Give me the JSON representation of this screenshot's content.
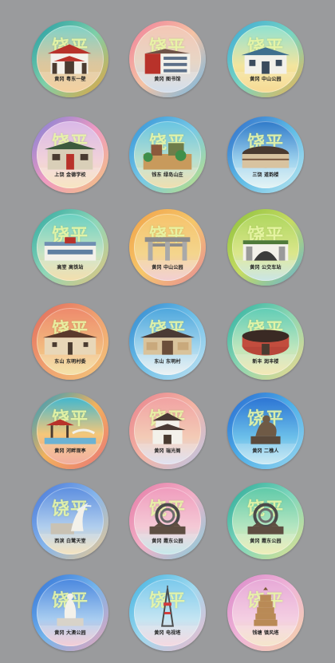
{
  "watermark": "饶平",
  "badges": [
    {
      "label": "黄冈 粤东一壁",
      "ring": "linear-gradient(135deg,#1f9aa6,#7fd0a8,#e9a23a)",
      "bg": "linear-gradient(180deg,#7fd2c8,#d9c7a0 55%,#f2c68a)",
      "icon": "gate-arch-icon"
    },
    {
      "label": "黄冈 图书馆",
      "ring": "linear-gradient(135deg,#f07c9a,#f5c3a4,#6fb8e6)",
      "bg": "linear-gradient(180deg,#f4c7b5,#e7d6c6 55%,#c9d7e8)",
      "icon": "library-building-icon"
    },
    {
      "label": "黄冈 中山公园",
      "ring": "linear-gradient(135deg,#3aa6d8,#78d6c2,#f2b24c)",
      "bg": "linear-gradient(180deg,#8fe1d2,#f3e59e 60%,#f6d27c)",
      "icon": "park-pavilion-icon"
    },
    {
      "label": "上饶 金德学校",
      "ring": "linear-gradient(135deg,#7a7fd8,#ef9ac2,#f2c57c)",
      "bg": "linear-gradient(180deg,#d9b8e8,#f2d3d9 60%,#f6e0b4)",
      "icon": "school-building-icon"
    },
    {
      "label": "钱东 绿岛山庄",
      "ring": "linear-gradient(135deg,#2f8fd8,#77c9e6,#c3e27a)",
      "bg": "linear-gradient(180deg,#67c4e2,#b9e0cf 60%,#ecd79d)",
      "icon": "resort-building-icon"
    },
    {
      "label": "三饶 道韵楼",
      "ring": "linear-gradient(135deg,#2e68c8,#5dbbe6,#bfe8f0)",
      "bg": "linear-gradient(180deg,#2f7ac9,#9fd3ee 60%,#dff2f3)",
      "icon": "tulou-icon"
    },
    {
      "label": "高堂 高铁站",
      "ring": "linear-gradient(135deg,#2aa6a0,#8fd7b8,#e4c37a)",
      "bg": "linear-gradient(180deg,#6ad0c1,#c6e3c3 60%,#f1d79b)",
      "icon": "station-icon"
    },
    {
      "label": "黄冈 中山公园",
      "ring": "linear-gradient(135deg,#f0a048,#f6c76a,#e68a9a)",
      "bg": "linear-gradient(180deg,#f6c36b,#f4d58d 60%,#eec4c9)",
      "icon": "memorial-arch-icon"
    },
    {
      "label": "黄冈 公交车站",
      "ring": "linear-gradient(135deg,#8cbf3c,#c6dc63,#5fb1d8)",
      "bg": "linear-gradient(180deg,#aed65e,#dbe78c 60%,#bfe0e1)",
      "icon": "bus-station-icon"
    },
    {
      "label": "东山 东明村委",
      "ring": "linear-gradient(135deg,#e06a5c,#f0a070,#f3c77a)",
      "bg": "linear-gradient(180deg,#ee8a6c,#f2ba7f 60%,#f2dc98)",
      "icon": "village-hall-icon"
    },
    {
      "label": "东山 东明村",
      "ring": "linear-gradient(135deg,#2f86cf,#6ec0e8,#c4e3f2)",
      "bg": "linear-gradient(180deg,#4ea7dd,#a4d6ee 60%,#e8eff1)",
      "icon": "ancestral-hall-icon"
    },
    {
      "label": "新丰 润丰楼",
      "ring": "linear-gradient(135deg,#2bb0a2,#8ed7b2,#f3d98a)",
      "bg": "linear-gradient(180deg,#61cdb6,#bde6bd 60%,#f2e3a6)",
      "icon": "round-tulou-icon"
    },
    {
      "label": "黄冈 河畔观亭",
      "ring": "linear-gradient(135deg,#1e9bc5,#f3b25c,#e9737a)",
      "bg": "linear-gradient(180deg,#40b7cf,#f4c77a 55%,#f09c8a)",
      "icon": "river-pavilion-icon"
    },
    {
      "label": "黄冈 瑞光阁",
      "ring": "linear-gradient(135deg,#e7828d,#f4b4a4,#b9c6e9)",
      "bg": "linear-gradient(180deg,#f1a2a2,#f3cbb6 60%,#d9dbee)",
      "icon": "tower-pavilion-icon"
    },
    {
      "label": "黄冈 二樵人",
      "ring": "linear-gradient(135deg,#2767d0,#4fb0e8,#9ad7ef)",
      "bg": "linear-gradient(180deg,#2b74d4,#6cc0ea 60%,#c2e6f2)",
      "icon": "statue-icon"
    },
    {
      "label": "西滨 白鹭天堂",
      "ring": "linear-gradient(135deg,#4574d8,#86b6ec,#f0c98a)",
      "bg": "linear-gradient(180deg,#5d8fe0,#b2cfee 60%,#f2ddb1)",
      "icon": "egret-sculpture-icon"
    },
    {
      "label": "黄冈 霞东公园",
      "ring": "linear-gradient(135deg,#e57aa6,#f2b0c7,#7fd0dc)",
      "bg": "linear-gradient(180deg,#f09cbd,#f4cad6 60%,#b9e4e6)",
      "icon": "spiral-sculpture-icon"
    },
    {
      "label": "黄冈 霞东公园",
      "ring": "linear-gradient(135deg,#28a897,#7fd7bd,#e7e28e)",
      "bg": "linear-gradient(180deg,#5fcaa9,#b6e6c1 60%,#ecebaa)",
      "icon": "spiral-sculpture-icon"
    },
    {
      "label": "黄冈 大澳公园",
      "ring": "linear-gradient(135deg,#2f6fd6,#74b5ec,#f2a4b6)",
      "bg": "linear-gradient(180deg,#4b88df,#a9cdf0 60%,#f2c3cd)",
      "icon": "guanyin-statue-icon"
    },
    {
      "label": "黄冈 电视塔",
      "ring": "linear-gradient(135deg,#3fb1e0,#9fd9ef,#f2b7c9)",
      "bg": "linear-gradient(180deg,#7ac9ec,#c5e5f2 60%,#f3d0da)",
      "icon": "tv-tower-icon"
    },
    {
      "label": "钱塘 镇风塔",
      "ring": "linear-gradient(135deg,#d987c9,#f0b6d8,#f3d3a4)",
      "bg": "linear-gradient(180deg,#e7a9d7,#f4cfe2 60%,#f3e0c1)",
      "icon": "pagoda-icon"
    }
  ]
}
